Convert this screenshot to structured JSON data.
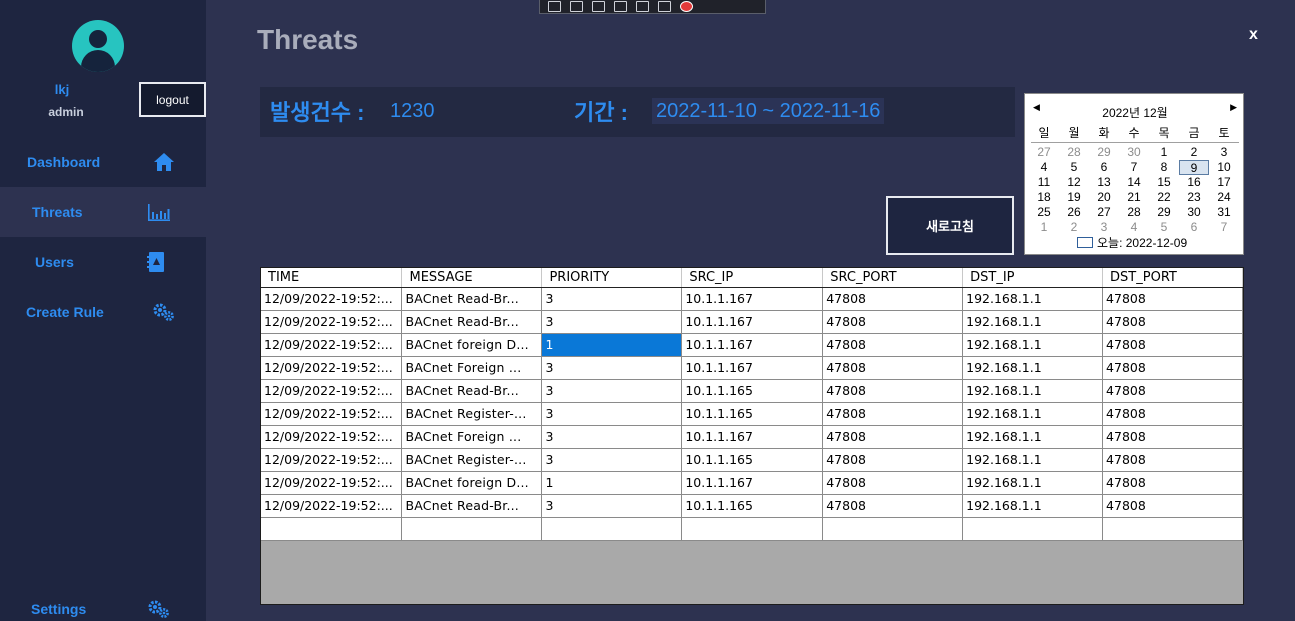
{
  "app": {
    "page_title": "Threats",
    "close_label": "x"
  },
  "user": {
    "name": "lkj",
    "role": "admin",
    "logout_label": "logout"
  },
  "nav": [
    {
      "label": "Dashboard",
      "icon": "home-icon"
    },
    {
      "label": "Threats",
      "icon": "bar-chart-icon"
    },
    {
      "label": "Users",
      "icon": "contacts-book-icon"
    },
    {
      "label": "Create Rule",
      "icon": "gears-icon"
    },
    {
      "label": "Settings",
      "icon": "gears-icon"
    }
  ],
  "summary": {
    "count_label": "발생건수 :",
    "count_value": "1230",
    "period_label": "기간 :",
    "period_value": "2022-11-10 ~ 2022-11-16"
  },
  "refresh_label": "새로고침",
  "calendar": {
    "month_title": "2022년 12월",
    "weekdays": [
      "일",
      "월",
      "화",
      "수",
      "목",
      "금",
      "토"
    ],
    "weeks": [
      [
        "27",
        "28",
        "29",
        "30",
        "1",
        "2",
        "3"
      ],
      [
        "4",
        "5",
        "6",
        "7",
        "8",
        "9",
        "10"
      ],
      [
        "11",
        "12",
        "13",
        "14",
        "15",
        "16",
        "17"
      ],
      [
        "18",
        "19",
        "20",
        "21",
        "22",
        "23",
        "24"
      ],
      [
        "25",
        "26",
        "27",
        "28",
        "29",
        "30",
        "31"
      ],
      [
        "1",
        "2",
        "3",
        "4",
        "5",
        "6",
        "7"
      ]
    ],
    "selected_day": "9",
    "today_label": "오늘: 2022-12-09"
  },
  "table": {
    "columns": [
      "TIME",
      "MESSAGE",
      "PRIORITY",
      "SRC_IP",
      "SRC_PORT",
      "DST_IP",
      "DST_PORT"
    ],
    "rows": [
      [
        "12/09/2022-19:52:...",
        "BACnet Read-Br...",
        "3",
        "10.1.1.167",
        "47808",
        "192.168.1.1",
        "47808"
      ],
      [
        "12/09/2022-19:52:...",
        "BACnet Read-Br...",
        "3",
        "10.1.1.167",
        "47808",
        "192.168.1.1",
        "47808"
      ],
      [
        "12/09/2022-19:52:...",
        "BACnet foreign D...",
        "1",
        "10.1.1.167",
        "47808",
        "192.168.1.1",
        "47808"
      ],
      [
        "12/09/2022-19:52:...",
        "BACnet Foreign ...",
        "3",
        "10.1.1.167",
        "47808",
        "192.168.1.1",
        "47808"
      ],
      [
        "12/09/2022-19:52:...",
        "BACnet Read-Br...",
        "3",
        "10.1.1.165",
        "47808",
        "192.168.1.1",
        "47808"
      ],
      [
        "12/09/2022-19:52:...",
        "BACnet Register-...",
        "3",
        "10.1.1.165",
        "47808",
        "192.168.1.1",
        "47808"
      ],
      [
        "12/09/2022-19:52:...",
        "BACnet Foreign ...",
        "3",
        "10.1.1.167",
        "47808",
        "192.168.1.1",
        "47808"
      ],
      [
        "12/09/2022-19:52:...",
        "BACnet Register-...",
        "3",
        "10.1.1.165",
        "47808",
        "192.168.1.1",
        "47808"
      ],
      [
        "12/09/2022-19:52:...",
        "BACnet foreign D...",
        "1",
        "10.1.1.167",
        "47808",
        "192.168.1.1",
        "47808"
      ],
      [
        "12/09/2022-19:52:...",
        "BACnet Read-Br...",
        "3",
        "10.1.1.165",
        "47808",
        "192.168.1.1",
        "47808"
      ],
      [
        "",
        "",
        "",
        "",
        "",
        "",
        ""
      ]
    ],
    "selected_cell": {
      "row": 2,
      "col": 2
    }
  },
  "colors": {
    "accent": "#2e8cf0",
    "sidebar": "#1e2540",
    "background": "#2d3250",
    "selection": "#0a78d7"
  }
}
